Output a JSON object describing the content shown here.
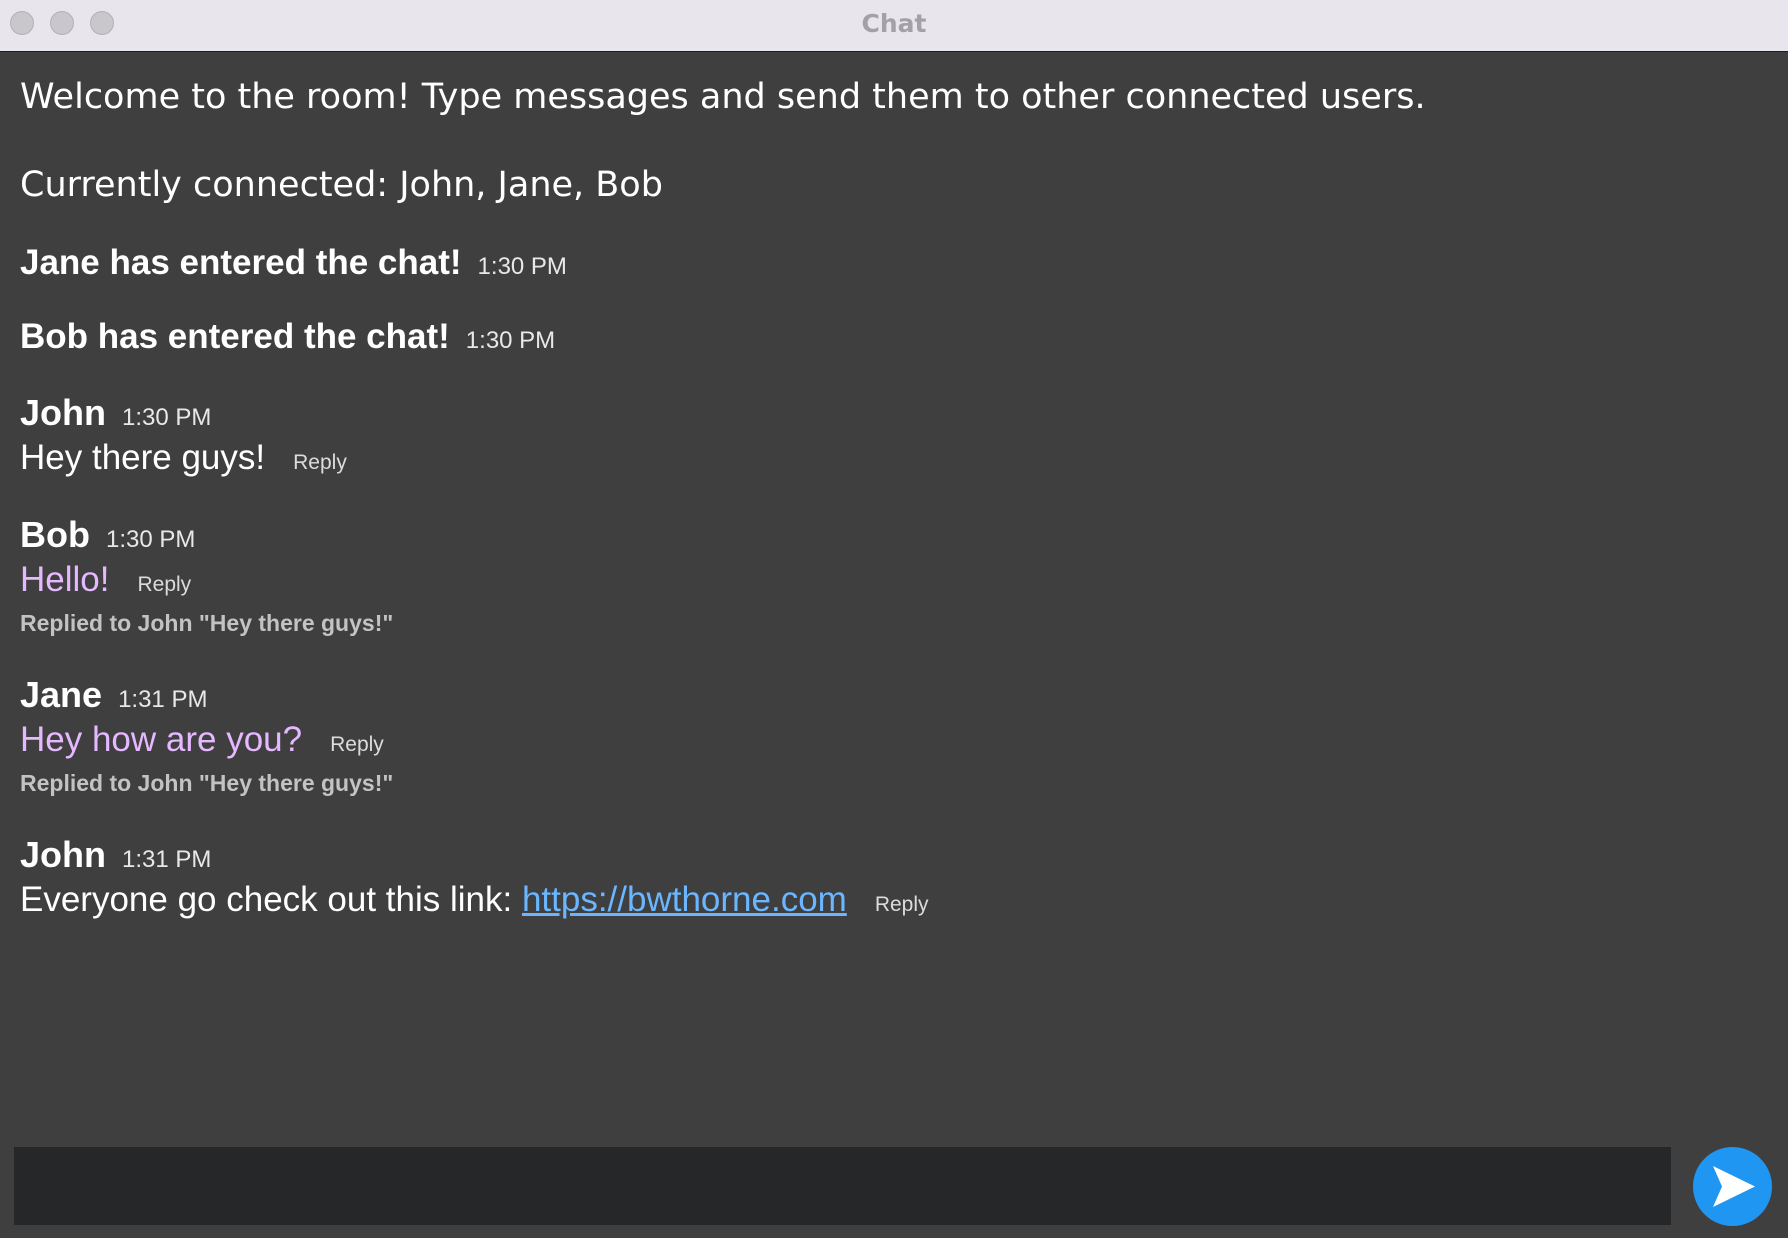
{
  "window": {
    "title": "Chat"
  },
  "chat": {
    "welcome": "Welcome to the room! Type messages and send them to other connected users.",
    "connected": "Currently connected: John, Jane, Bob",
    "system_messages": [
      {
        "text": "Jane has entered the chat!",
        "time": "1:30 PM"
      },
      {
        "text": "Bob has entered the chat!",
        "time": "1:30 PM"
      }
    ],
    "messages": [
      {
        "author": "John",
        "time": "1:30 PM",
        "text": "Hey there guys!",
        "reply_label": "Reply"
      },
      {
        "author": "Bob",
        "time": "1:30 PM",
        "text": "Hello!",
        "reply_label": "Reply",
        "replied_to": "Replied to John \"Hey there guys!\""
      },
      {
        "author": "Jane",
        "time": "1:31 PM",
        "text": "Hey how are you?",
        "reply_label": "Reply",
        "replied_to": "Replied to John \"Hey there guys!\""
      },
      {
        "author": "John",
        "time": "1:31 PM",
        "text": "Everyone go check out this link: ",
        "link": "https://bwthorne.com",
        "reply_label": "Reply"
      }
    ]
  },
  "composer": {
    "value": "",
    "send_icon": "send-arrow-icon"
  },
  "colors": {
    "background": "#3f3f40",
    "reply_text": "#e5b8ff",
    "link": "#6ab6ff",
    "send_button": "#1f97f2"
  }
}
